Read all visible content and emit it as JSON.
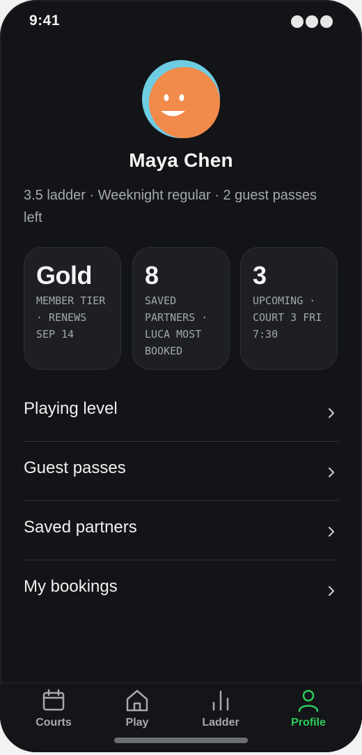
{
  "status": {
    "time": "9:41"
  },
  "profile": {
    "name": "Maya Chen",
    "subtitle": "3.5 ladder · Weeknight regular · 2 guest passes left"
  },
  "stats": [
    {
      "value": "Gold",
      "label": "Member tier · renews Sep 14"
    },
    {
      "value": "8",
      "label": "Saved partners · Luca most booked"
    },
    {
      "value": "3",
      "label": "Upcoming · Court 3 Fri 7:30"
    }
  ],
  "menu": [
    {
      "label": "Playing level"
    },
    {
      "label": "Guest passes"
    },
    {
      "label": "Saved partners"
    },
    {
      "label": "My bookings"
    }
  ],
  "tabs": [
    {
      "label": "Courts",
      "icon": "calendar-icon"
    },
    {
      "label": "Play",
      "icon": "home-icon"
    },
    {
      "label": "Ladder",
      "icon": "bar-chart-icon"
    },
    {
      "label": "Profile",
      "icon": "user-icon",
      "active": true
    }
  ],
  "colors": {
    "accent": "#2ecc5c",
    "avatar_bg": "#6ecde2",
    "avatar_face": "#f28a4a",
    "background": "#131417",
    "card": "#1d1f24"
  }
}
